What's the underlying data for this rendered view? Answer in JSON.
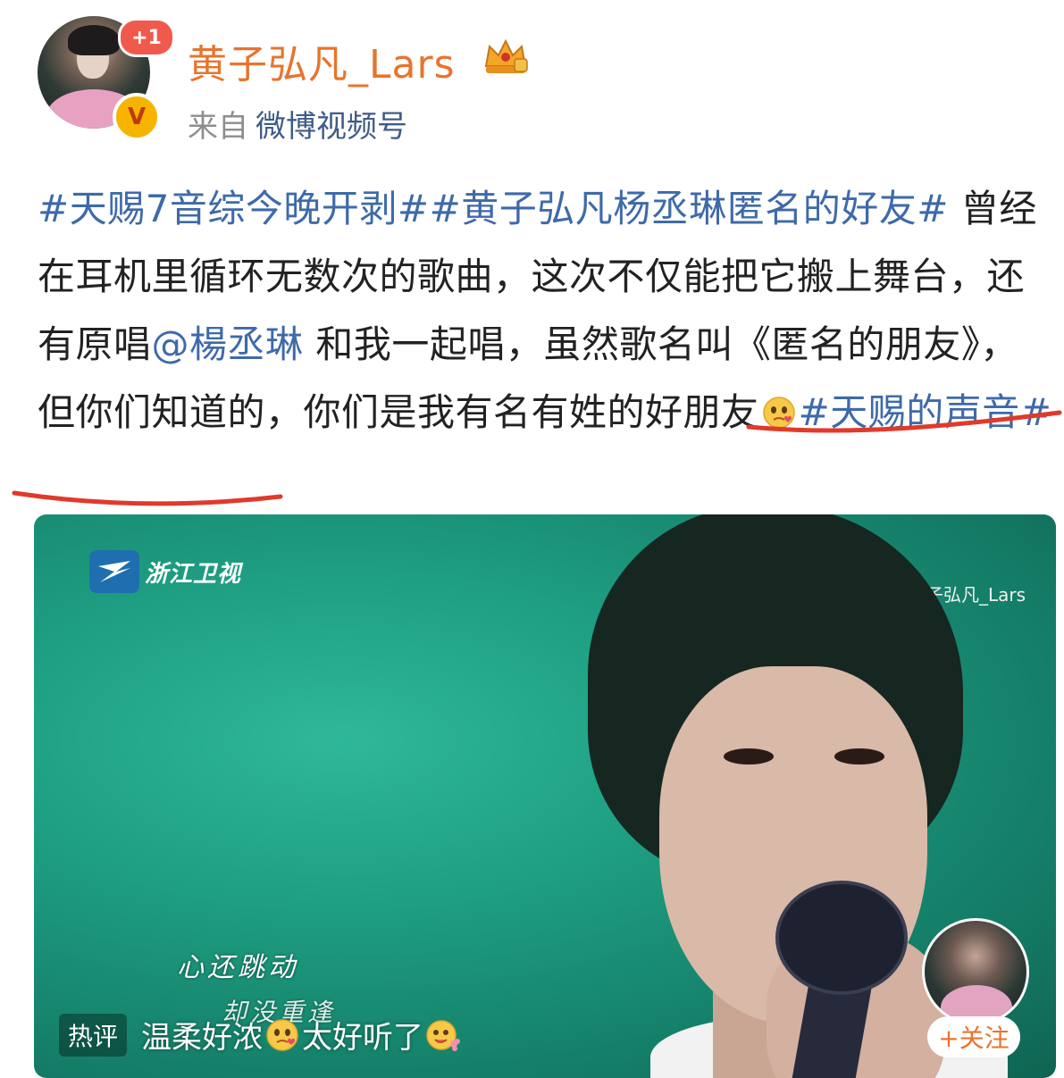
{
  "header": {
    "notification_badge": "+1",
    "username": "黄子弘凡_Lars",
    "source_prefix": "来自",
    "source_name": "微博视频号"
  },
  "post": {
    "tag1": "#天赐7音综今晚开剥#",
    "tag2": "#黄子弘凡杨丞琳匿名的好友#",
    "text1": " 曾经在耳机里循环无数次的歌曲，这次不仅能把它搬上舞台，还有原唱",
    "mention": "@楊丞琳",
    "text2": " 和我一起唱，虽然歌名叫《匿名的朋友》，但你们知道的，",
    "highlight": "你们是我有名有姓的好朋友",
    "tag3": "#天赐的声音#"
  },
  "video": {
    "channel_logo_text": "浙江卫视",
    "watermark": "@黄子弘凡_Lars",
    "lyric_line1": "心还跳动",
    "lyric_line2": "却没重逢",
    "hot_comment_label": "热评",
    "hot_comment_part1": "温柔好浓",
    "hot_comment_part2": "太好听了",
    "follow_label": "+关注"
  },
  "colors": {
    "username": "#e8742d",
    "link": "#3e6aa9",
    "underline": "#e03a2a",
    "video_bg": "#1e9e82"
  },
  "icons": [
    "verified-icon",
    "crown-badge-icon",
    "heart-eyes-emoji-icon",
    "flower-emoji-icon",
    "zhejiang-tv-logo-icon"
  ]
}
